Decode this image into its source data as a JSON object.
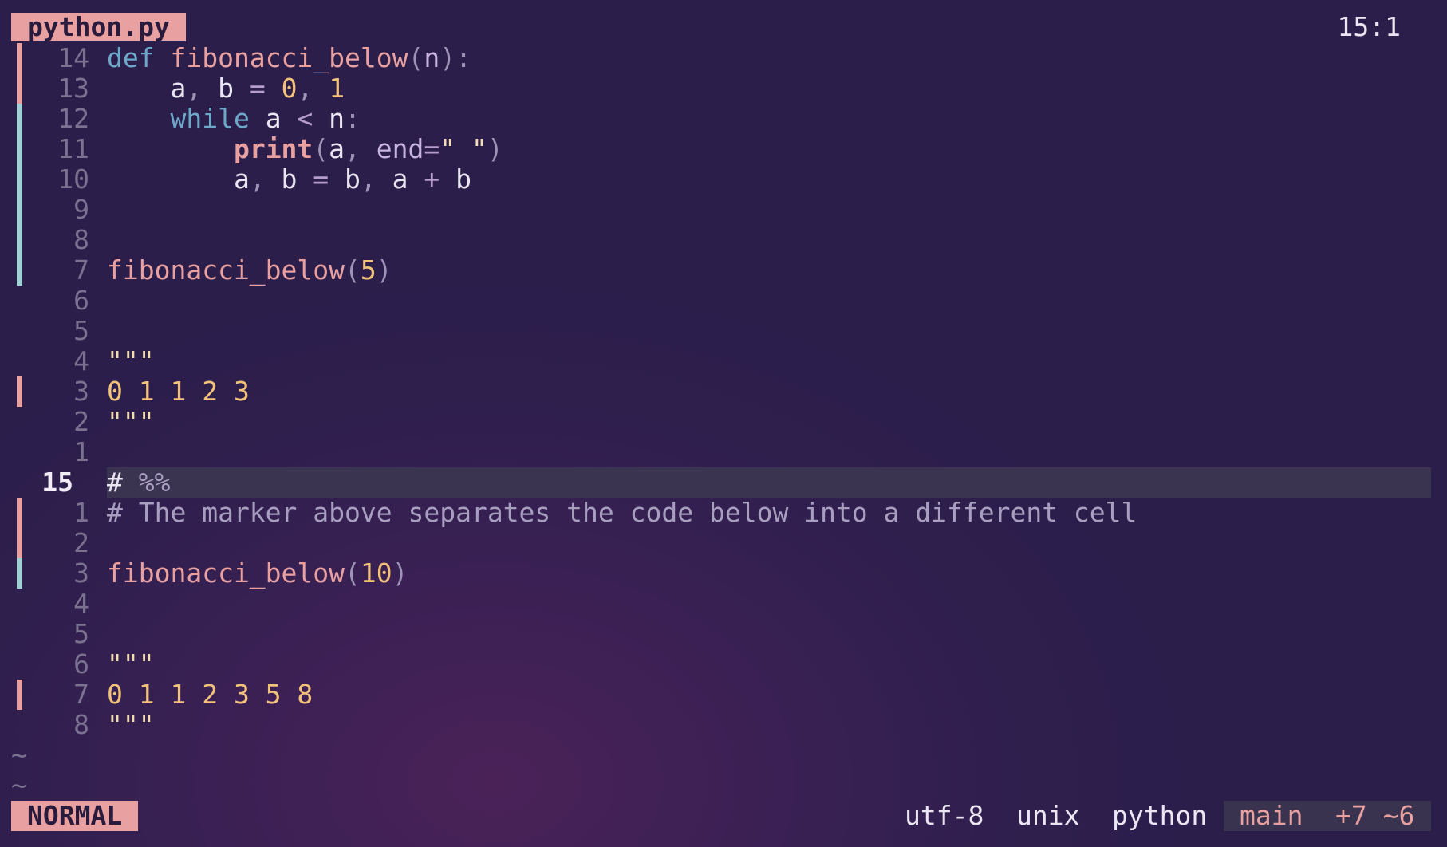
{
  "file_tab": "python.py",
  "cursor_position": "15:1",
  "mode": "NORMAL",
  "status": {
    "encoding": "utf-8",
    "format": "unix",
    "filetype": "python",
    "branch": "main",
    "diff": "+7 ~6"
  },
  "colors": {
    "added": "#9fd0d6",
    "changed": "#e8a0a0",
    "keyword": "#6ea8c8",
    "function": "#e8a0a0",
    "number": "#f2c27a"
  },
  "lines": [
    {
      "num": "14",
      "git": "changed",
      "tokens": [
        [
          "kw",
          "def"
        ],
        [
          "id",
          " "
        ],
        [
          "fn",
          "fibonacci_below"
        ],
        [
          "punc",
          "("
        ],
        [
          "param",
          "n"
        ],
        [
          "punc",
          "):"
        ]
      ]
    },
    {
      "num": "13",
      "git": "changed",
      "tokens": [
        [
          "id",
          "    a"
        ],
        [
          "punc",
          ","
        ],
        [
          "id",
          " b "
        ],
        [
          "op",
          "="
        ],
        [
          "id",
          " "
        ],
        [
          "num",
          "0"
        ],
        [
          "punc",
          ","
        ],
        [
          "id",
          " "
        ],
        [
          "num",
          "1"
        ]
      ]
    },
    {
      "num": "12",
      "git": "added",
      "tokens": [
        [
          "id",
          "    "
        ],
        [
          "kw",
          "while"
        ],
        [
          "id",
          " a "
        ],
        [
          "op",
          "<"
        ],
        [
          "id",
          " n"
        ],
        [
          "punc",
          ":"
        ]
      ]
    },
    {
      "num": "11",
      "git": "added",
      "tokens": [
        [
          "id",
          "        "
        ],
        [
          "fnb",
          "print"
        ],
        [
          "punc",
          "("
        ],
        [
          "id",
          "a"
        ],
        [
          "punc",
          ","
        ],
        [
          "id",
          " "
        ],
        [
          "param",
          "end"
        ],
        [
          "op",
          "="
        ],
        [
          "str",
          "\" \""
        ],
        [
          "punc",
          ")"
        ]
      ]
    },
    {
      "num": "10",
      "git": "added",
      "tokens": [
        [
          "id",
          "        a"
        ],
        [
          "punc",
          ","
        ],
        [
          "id",
          " b "
        ],
        [
          "op",
          "="
        ],
        [
          "id",
          " b"
        ],
        [
          "punc",
          ","
        ],
        [
          "id",
          " a "
        ],
        [
          "op",
          "+"
        ],
        [
          "id",
          " b"
        ]
      ]
    },
    {
      "num": "9",
      "git": "added",
      "tokens": []
    },
    {
      "num": "8",
      "git": "added",
      "tokens": []
    },
    {
      "num": "7",
      "git": "added",
      "tokens": [
        [
          "fn",
          "fibonacci_below"
        ],
        [
          "punc",
          "("
        ],
        [
          "num",
          "5"
        ],
        [
          "punc",
          ")"
        ]
      ]
    },
    {
      "num": "6",
      "git": "",
      "tokens": []
    },
    {
      "num": "5",
      "git": "",
      "tokens": []
    },
    {
      "num": "4",
      "git": "",
      "tokens": [
        [
          "str",
          "\"\"\""
        ]
      ]
    },
    {
      "num": "3",
      "git": "changed",
      "tokens": [
        [
          "num",
          "0 1 1 2 3"
        ]
      ]
    },
    {
      "num": "2",
      "git": "",
      "tokens": [
        [
          "str",
          "\"\"\""
        ]
      ]
    },
    {
      "num": "1",
      "git": "",
      "tokens": []
    },
    {
      "num": "15",
      "git": "",
      "current": true,
      "tokens": [
        [
          "id",
          "#"
        ],
        [
          "cmt",
          " %%"
        ]
      ]
    },
    {
      "num": "1",
      "git": "changed",
      "tokens": [
        [
          "cmt",
          "# The marker above separates the code below into a different cell"
        ]
      ]
    },
    {
      "num": "2",
      "git": "changed",
      "tokens": []
    },
    {
      "num": "3",
      "git": "added",
      "tokens": [
        [
          "fn",
          "fibonacci_below"
        ],
        [
          "punc",
          "("
        ],
        [
          "num",
          "10"
        ],
        [
          "punc",
          ")"
        ]
      ]
    },
    {
      "num": "4",
      "git": "",
      "tokens": []
    },
    {
      "num": "5",
      "git": "",
      "tokens": []
    },
    {
      "num": "6",
      "git": "",
      "tokens": [
        [
          "str",
          "\"\"\""
        ]
      ]
    },
    {
      "num": "7",
      "git": "changed",
      "tokens": [
        [
          "num",
          "0 1 1 2 3 5 8"
        ]
      ]
    },
    {
      "num": "8",
      "git": "",
      "tokens": [
        [
          "str",
          "\"\"\""
        ]
      ]
    }
  ],
  "empty_markers": [
    "~",
    "~"
  ]
}
